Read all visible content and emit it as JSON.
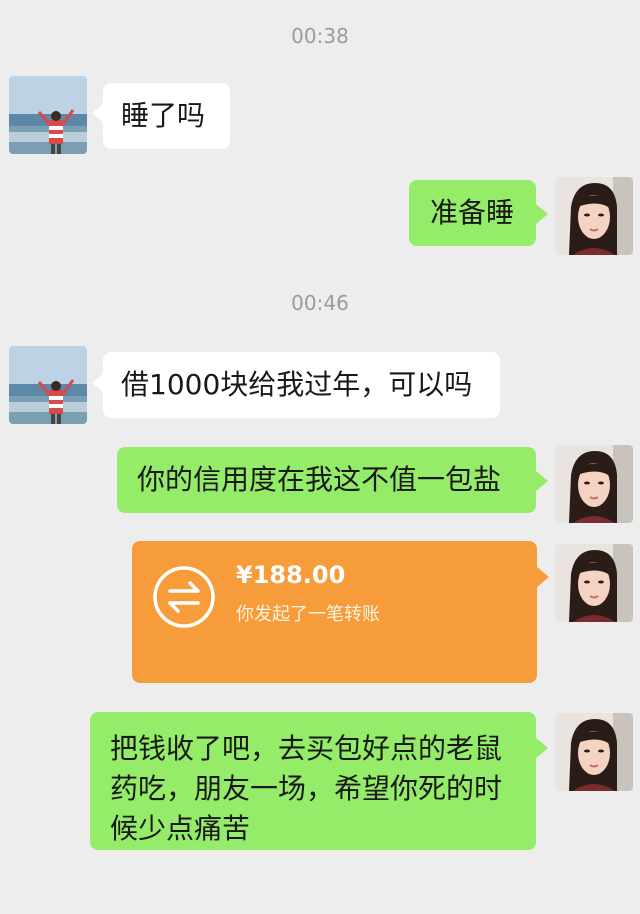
{
  "chat": {
    "timestamp_1": "00:38",
    "msg_1": "睡了吗",
    "msg_2": "准备睡",
    "timestamp_2": "00:46",
    "msg_3": "借1000块给我过年，可以吗",
    "msg_4": "你的信用度在我这不值一包盐",
    "transfer": {
      "amount": "¥188.00",
      "description": "你发起了一笔转账"
    },
    "msg_5": "把钱收了吧，去买包好点的老鼠药吃，朋友一场，希望你死的时候少点痛苦"
  },
  "colors": {
    "background": "#ededed",
    "incoming_bubble": "#ffffff",
    "outgoing_bubble": "#95ec69",
    "transfer_card": "#f79c3a"
  },
  "icons": {
    "transfer": "transfer-arrows-icon",
    "contact_avatar": "beach-photo-avatar",
    "self_avatar": "portrait-avatar"
  }
}
